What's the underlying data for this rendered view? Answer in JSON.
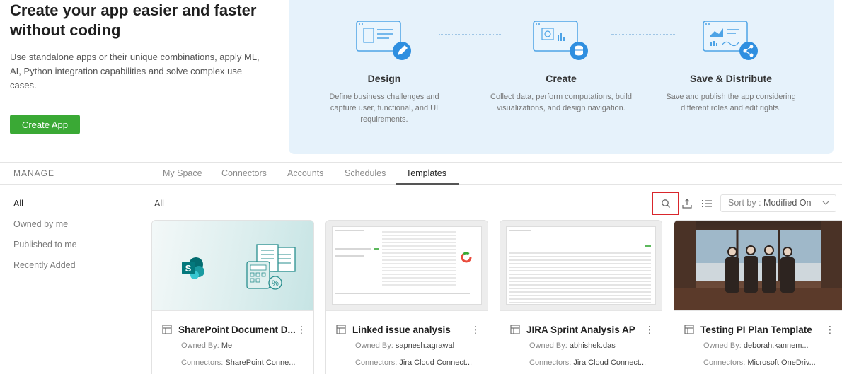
{
  "hero": {
    "title": "Create your app easier and faster without coding",
    "description": "Use standalone apps or their unique combinations, apply ML, AI, Python integration capabilities and solve complex use cases.",
    "create_button": "Create App",
    "steps": [
      {
        "title": "Design",
        "desc": "Define business challenges and capture user, functional, and UI requirements.",
        "icon": "design-illustration"
      },
      {
        "title": "Create",
        "desc": "Collect data, perform computations, build visualizations, and design navigation.",
        "icon": "create-illustration"
      },
      {
        "title": "Save & Distribute",
        "desc": "Save and publish the app considering different roles and edit rights.",
        "icon": "share-illustration"
      }
    ]
  },
  "tabs": {
    "manage_label": "MANAGE",
    "items": [
      "My Space",
      "Connectors",
      "Accounts",
      "Schedules",
      "Templates"
    ],
    "active": "Templates"
  },
  "filters": {
    "items": [
      "All",
      "Owned by me",
      "Published to me",
      "Recently Added"
    ],
    "active": "All"
  },
  "toolbar": {
    "breadcrumb": "All",
    "sort_label": "Sort by :",
    "sort_value": "Modified On",
    "icons": [
      "search-icon",
      "upload-icon",
      "list-view-icon"
    ]
  },
  "cards": [
    {
      "title": "SharePoint Document D...",
      "owned_label": "Owned By:",
      "owner": "Me",
      "connectors_label": "Connectors:",
      "connectors": "SharePoint Conne..."
    },
    {
      "title": "Linked issue analysis",
      "owned_label": "Owned By:",
      "owner": "sapnesh.agrawal",
      "connectors_label": "Connectors:",
      "connectors": "Jira Cloud Connect..."
    },
    {
      "title": "JIRA Sprint Analysis AP",
      "owned_label": "Owned By:",
      "owner": "abhishek.das",
      "connectors_label": "Connectors:",
      "connectors": "Jira Cloud Connect..."
    },
    {
      "title": "Testing PI Plan Template",
      "owned_label": "Owned By:",
      "owner": "deborah.kannem...",
      "connectors_label": "Connectors:",
      "connectors": "Microsoft OneDriv..."
    }
  ],
  "colors": {
    "accent_green": "#3aa935",
    "hero_bg": "#e6f2fb",
    "icon_blue": "#2f8fe0",
    "highlight_red": "#d9262c"
  }
}
